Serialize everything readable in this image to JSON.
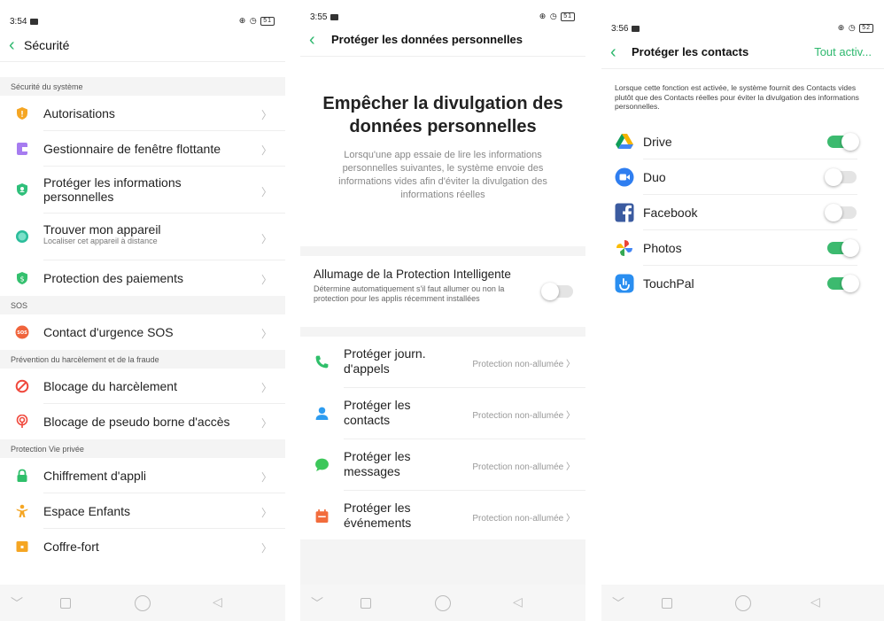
{
  "screens": [
    {
      "status": {
        "time": "3:54"
      },
      "title": "Sécurité",
      "sections": [
        {
          "header": "Sécurité du système",
          "items": [
            {
              "label": "Autorisations",
              "icon": "shield-icon"
            },
            {
              "label": "Gestionnaire de fenêtre flottante",
              "icon": "floating-window-icon"
            },
            {
              "label": "Protéger les informations personnelles",
              "icon": "privacy-shield-icon"
            },
            {
              "label": "Trouver mon appareil",
              "sub": "Localiser cet appareil à distance",
              "icon": "locate-icon"
            },
            {
              "label": "Protection des paiements",
              "icon": "payment-shield-icon"
            }
          ]
        },
        {
          "header": "SOS",
          "items": [
            {
              "label": "Contact d'urgence SOS",
              "icon": "sos-icon"
            }
          ]
        },
        {
          "header": "Prévention du harcèlement et de la fraude",
          "items": [
            {
              "label": "Blocage du harcèlement",
              "icon": "block-icon"
            },
            {
              "label": "Blocage de pseudo borne d'accès",
              "icon": "hotspot-icon"
            }
          ]
        },
        {
          "header": "Protection Vie privée",
          "items": [
            {
              "label": "Chiffrement d'appli",
              "icon": "lock-icon"
            },
            {
              "label": "Espace Enfants",
              "icon": "child-icon"
            },
            {
              "label": "Coffre-fort",
              "icon": "safe-icon"
            }
          ]
        }
      ]
    },
    {
      "status": {
        "time": "3:55"
      },
      "title": "Protéger les données personnelles",
      "hero": {
        "title": "Empêcher la divulgation des données personnelles",
        "text": "Lorsqu'une app essaie de lire les informations personnelles suivantes, le système envoie des informations vides afin d'éviter la divulgation des informations réelles"
      },
      "smart": {
        "title": "Allumage de la Protection Intelligente",
        "desc": "Détermine automatiquement s'il faut allumer ou non la protection pour les applis récemment installées",
        "enabled": false
      },
      "protections": [
        {
          "label": "Protéger journ. d'appels",
          "status": "Protection non-allumée",
          "icon": "phone-icon"
        },
        {
          "label": "Protéger les contacts",
          "status": "Protection non-allumée",
          "icon": "contact-icon"
        },
        {
          "label": "Protéger les messages",
          "status": "Protection non-allumée",
          "icon": "message-icon"
        },
        {
          "label": "Protéger les événements",
          "status": "Protection non-allumée",
          "icon": "calendar-icon"
        }
      ]
    },
    {
      "status": {
        "time": "3:56"
      },
      "title": "Protéger les contacts",
      "action": "Tout activ...",
      "desc": "Lorsque cette fonction est activée, le système fournit des Contacts vides plutôt que des Contacts réelles pour éviter la divulgation des informations personnelles.",
      "apps": [
        {
          "label": "Drive",
          "enabled": true,
          "icon": "drive-icon"
        },
        {
          "label": "Duo",
          "enabled": false,
          "icon": "duo-icon"
        },
        {
          "label": "Facebook",
          "enabled": false,
          "icon": "facebook-icon"
        },
        {
          "label": "Photos",
          "enabled": true,
          "icon": "photos-icon"
        },
        {
          "label": "TouchPal",
          "enabled": true,
          "icon": "touchpal-icon"
        }
      ]
    }
  ],
  "chevron": "〉",
  "status_icons": "⊕ ◷",
  "battery": [
    "51",
    "51",
    "52"
  ],
  "colors": {
    "accent": "#2eb86e",
    "toggle_on": "#3cba6f"
  }
}
